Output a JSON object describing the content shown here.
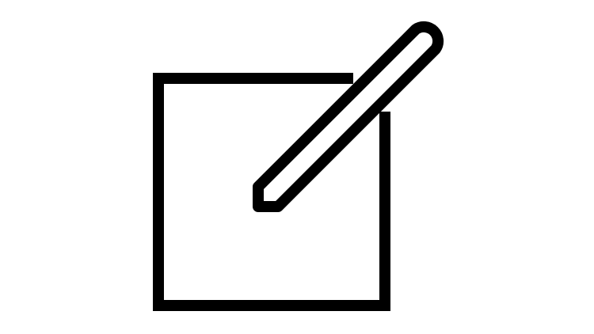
{
  "icon": {
    "name": "edit-icon",
    "stroke_color": "#000000",
    "fill_color": "#ffffff",
    "background_color": "#ffffff"
  }
}
